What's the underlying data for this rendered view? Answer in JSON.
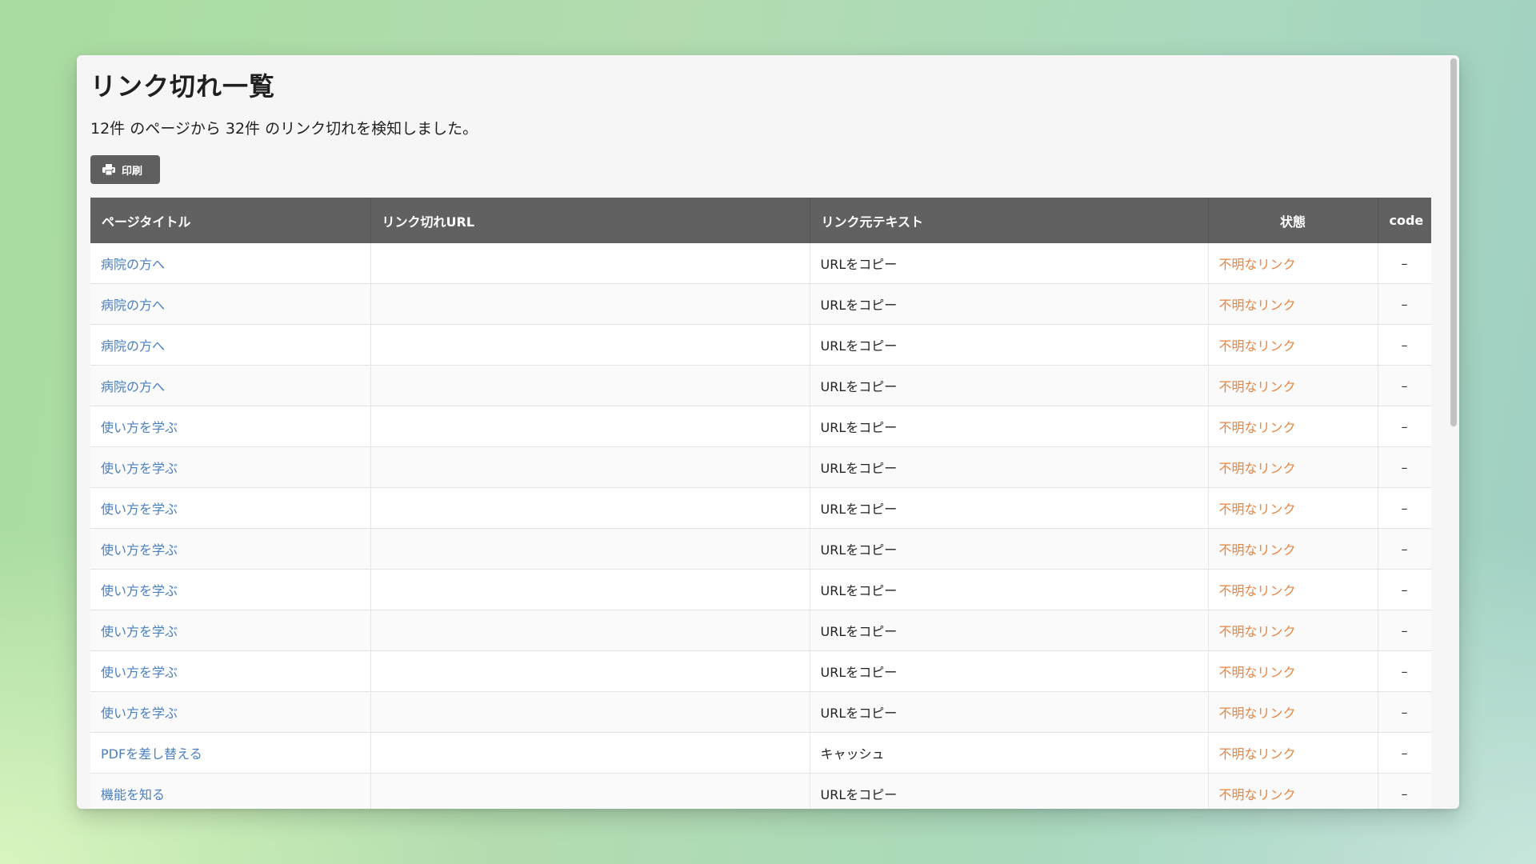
{
  "page": {
    "title": "リンク切れ一覧",
    "summary": "12件 のページから 32件 のリンク切れを検知しました。",
    "print_label": "印刷"
  },
  "table": {
    "headers": {
      "page_title": "ページタイトル",
      "broken_url": "リンク切れURL",
      "source_text": "リンク元テキスト",
      "status": "状態",
      "code": "code"
    },
    "rows": [
      {
        "page": "病院の方へ",
        "url": "",
        "text": "URLをコピー",
        "status": "不明なリンク",
        "code": "–"
      },
      {
        "page": "病院の方へ",
        "url": "",
        "text": "URLをコピー",
        "status": "不明なリンク",
        "code": "–"
      },
      {
        "page": "病院の方へ",
        "url": "",
        "text": "URLをコピー",
        "status": "不明なリンク",
        "code": "–"
      },
      {
        "page": "病院の方へ",
        "url": "",
        "text": "URLをコピー",
        "status": "不明なリンク",
        "code": "–"
      },
      {
        "page": "使い方を学ぶ",
        "url": "",
        "text": "URLをコピー",
        "status": "不明なリンク",
        "code": "–"
      },
      {
        "page": "使い方を学ぶ",
        "url": "",
        "text": "URLをコピー",
        "status": "不明なリンク",
        "code": "–"
      },
      {
        "page": "使い方を学ぶ",
        "url": "",
        "text": "URLをコピー",
        "status": "不明なリンク",
        "code": "–"
      },
      {
        "page": "使い方を学ぶ",
        "url": "",
        "text": "URLをコピー",
        "status": "不明なリンク",
        "code": "–"
      },
      {
        "page": "使い方を学ぶ",
        "url": "",
        "text": "URLをコピー",
        "status": "不明なリンク",
        "code": "–"
      },
      {
        "page": "使い方を学ぶ",
        "url": "",
        "text": "URLをコピー",
        "status": "不明なリンク",
        "code": "–"
      },
      {
        "page": "使い方を学ぶ",
        "url": "",
        "text": "URLをコピー",
        "status": "不明なリンク",
        "code": "–"
      },
      {
        "page": "使い方を学ぶ",
        "url": "",
        "text": "URLをコピー",
        "status": "不明なリンク",
        "code": "–"
      },
      {
        "page": "PDFを差し替える",
        "url": "",
        "text": "キャッシュ",
        "status": "不明なリンク",
        "code": "–"
      },
      {
        "page": "機能を知る",
        "url": "",
        "text": "URLをコピー",
        "status": "不明なリンク",
        "code": "–"
      }
    ]
  },
  "colors": {
    "header_bg": "#616161",
    "link": "#4a7fc1",
    "status": "#e88440"
  },
  "icons": {
    "print": "printer-icon"
  }
}
